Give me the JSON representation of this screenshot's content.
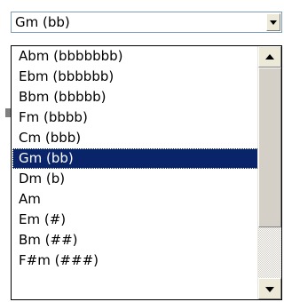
{
  "combo": {
    "selected_value": "Gm (bb)"
  },
  "dropdown": {
    "items": [
      {
        "label": "Abm (bbbbbbb)"
      },
      {
        "label": "Ebm (bbbbbb)"
      },
      {
        "label": "Bbm (bbbbb)"
      },
      {
        "label": "Fm (bbbb)"
      },
      {
        "label": "Cm (bbb)"
      },
      {
        "label": "Gm (bb)"
      },
      {
        "label": "Dm (b)"
      },
      {
        "label": "Am"
      },
      {
        "label": "Em (#)"
      },
      {
        "label": "Bm (##)"
      },
      {
        "label": "F#m (###)"
      }
    ],
    "selected_index": 5
  },
  "scrollbar": {
    "up_icon": "triangle-up-icon",
    "down_icon": "triangle-down-icon"
  },
  "colors": {
    "selection_bg": "#0a246a",
    "selection_text": "#ffffff",
    "combo_border": "#7f9db9",
    "button_face": "#ece9d8"
  }
}
